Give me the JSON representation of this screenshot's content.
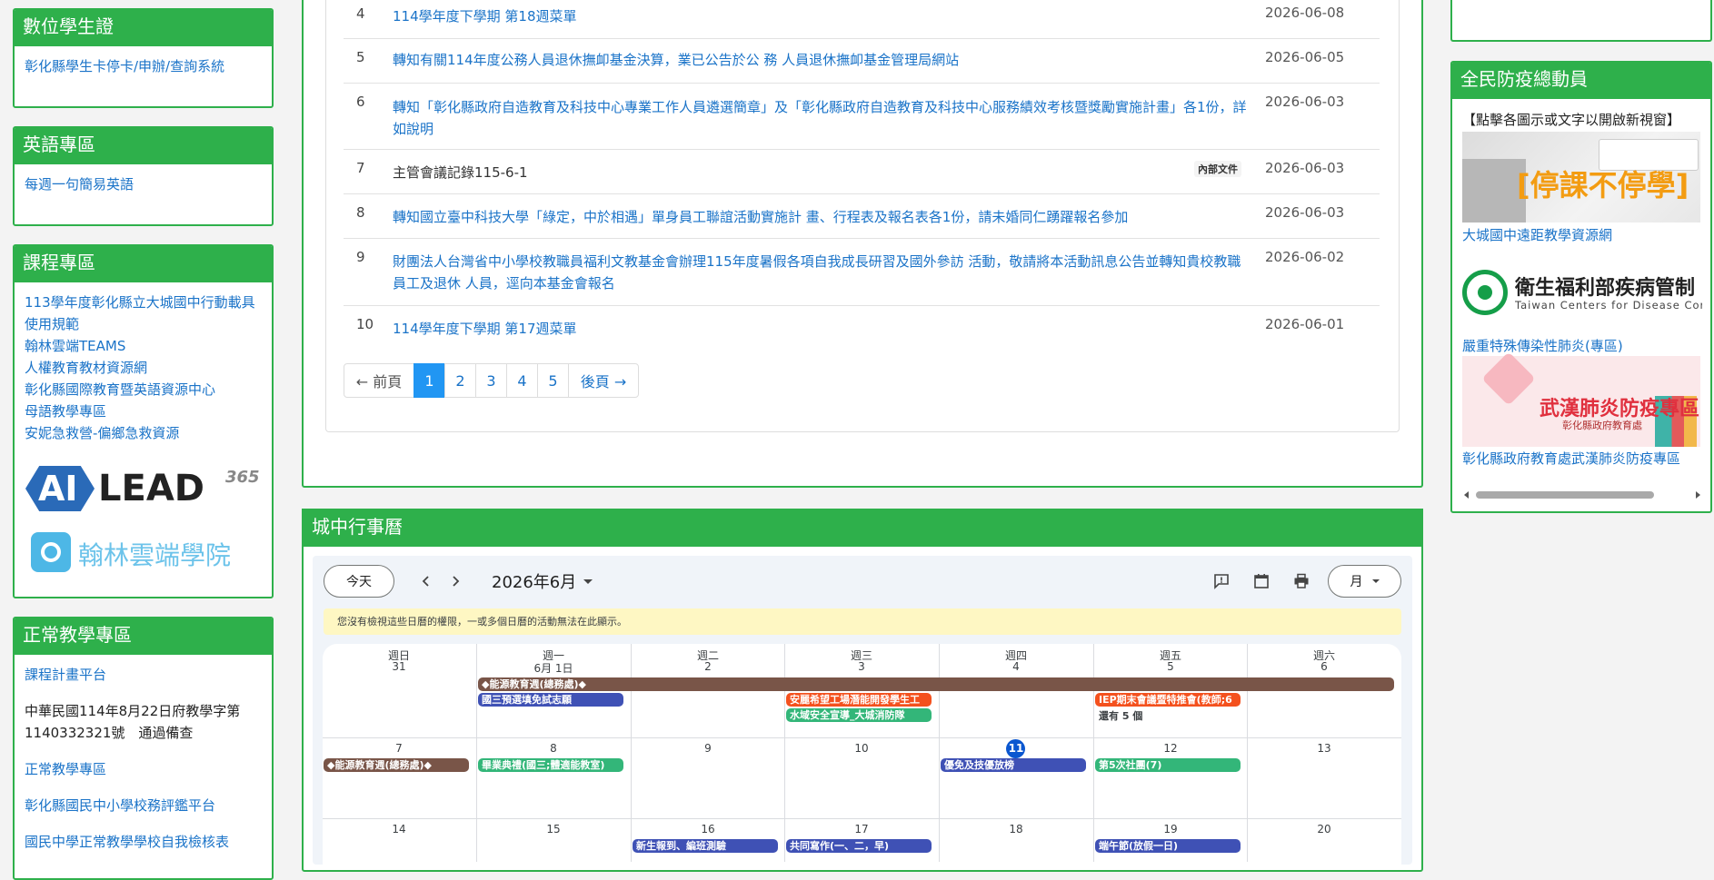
{
  "left": {
    "student_card": {
      "title": "數位學生證",
      "link": "彰化縣學生卡停卡/申辦/查詢系統"
    },
    "english": {
      "title": "英語專區",
      "link": "每週一句簡易英語"
    },
    "courses": {
      "title": "課程專區",
      "links": [
        "113學年度彰化縣立大城國中行動載具使用規範",
        "翰林雲端TEAMS",
        "人權教育教材資源網",
        "彰化縣國際教育暨英語資源中心",
        "母語教學專區",
        "安妮急救營-偏鄉急救資源"
      ],
      "logo_ai": "AI",
      "logo_lead": "LEAD",
      "logo_365": "365",
      "logo_hanlin": "翰林雲端學院"
    },
    "normal": {
      "title": "正常教學專區",
      "link1": "課程計畫平台",
      "text1": "中華民國114年8月22日府教學字第1140332321號　通過備查",
      "link2": "正常教學專區",
      "link3": "彰化縣國民中小學校務評鑑平台",
      "link4": "國民中學正常教學學校自我檢核表"
    }
  },
  "news": {
    "rows": [
      {
        "num": "4",
        "title": "114學年度下學期 第18週菜單",
        "date": "2026-06-08",
        "badge": ""
      },
      {
        "num": "5",
        "title": "轉知有關114年度公務人員退休撫卹基金決算，業已公告於公 務 人員退休撫卹基金管理局網站",
        "date": "2026-06-05",
        "badge": ""
      },
      {
        "num": "6",
        "title": "轉知「彰化縣政府自造教育及科技中心專業工作人員遴選簡章」及「彰化縣政府自造教育及科技中心服務績效考核暨獎勵實施計畫」各1份，詳如說明",
        "date": "2026-06-03",
        "badge": ""
      },
      {
        "num": "7",
        "title": "主管會議記錄115-6-1",
        "date": "2026-06-03",
        "badge": "內部文件"
      },
      {
        "num": "8",
        "title": "轉知國立臺中科技大學「綠定，中於相遇」單身員工聯誼活動實施計 畫、行程表及報名表各1份，請未婚同仁踴躍報名參加",
        "date": "2026-06-03",
        "badge": ""
      },
      {
        "num": "9",
        "title": "財團法人台灣省中小學校教職員福利文教基金會辦理115年度暑假各項自我成長研習及國外參訪 活動，敬請將本活動訊息公告並轉知貴校教職員工及退休 人員，逕向本基金會報名",
        "date": "2026-06-02",
        "badge": ""
      },
      {
        "num": "10",
        "title": "114學年度下學期 第17週菜單",
        "date": "2026-06-01",
        "badge": ""
      }
    ],
    "pager": {
      "prev": "← 前頁",
      "pages": [
        "1",
        "2",
        "3",
        "4",
        "5"
      ],
      "next": "後頁 →"
    }
  },
  "calendar": {
    "title": "城中行事曆",
    "today": "今天",
    "month_label": "2026年6月",
    "view": "月",
    "notice": "您沒有檢視這些日曆的權限，一或多個日曆的活動無法在此顯示。",
    "weekdays": [
      "週日",
      "週一",
      "週二",
      "週三",
      "週四",
      "週五",
      "週六"
    ],
    "week1_dates": [
      "31",
      "6月 1日",
      "2",
      "3",
      "4",
      "5",
      "6"
    ],
    "week2_dates": [
      "7",
      "8",
      "9",
      "10",
      "11",
      "12",
      "13"
    ],
    "week3_dates": [
      "14",
      "15",
      "16",
      "17",
      "18",
      "19",
      "20"
    ],
    "events": {
      "energy_week": "◆能源教育週(總務處)◆",
      "g3_exam": "國三預選填免試志願",
      "safe_factory": "安麗希望工場潛能開發學生工",
      "water_safety": "水域安全宣導_大城消防隊",
      "iep": "IEP期末會議暨特推會(教師;6",
      "more": "還有 5 個",
      "energy_week2": "◆能源教育週(總務處)◆",
      "graduation": "畢業典禮(國三;體適能教室)",
      "excellence": "優免及技優放榜",
      "club": "第5次社團(7)",
      "freshman": "新生報到、編班測驗",
      "writing": "共同寫作(一、二，早)",
      "dragon_boat": "端午節(放假一日)"
    }
  },
  "right": {
    "title": "全民防疫總動員",
    "hint": "【點擊各圖示或文字以開啟新視窗】",
    "img1_text": "[停課不停學]",
    "link1": "大城國中遠距教學資源網",
    "cdc_name": "衛生福利部疾病管制",
    "cdc_en": "Taiwan Centers for Disease Cor",
    "link2": "嚴重特殊傳染性肺炎(專區)",
    "img3_title": "武漢肺炎防疫專區",
    "img3_sub": "彰化縣政府教育處",
    "link3": "彰化縣政府教育處武漢肺炎防疫專區"
  },
  "colors": {
    "green": "#2eb04b",
    "link": "#1a73c8",
    "active": "#2196f3"
  }
}
